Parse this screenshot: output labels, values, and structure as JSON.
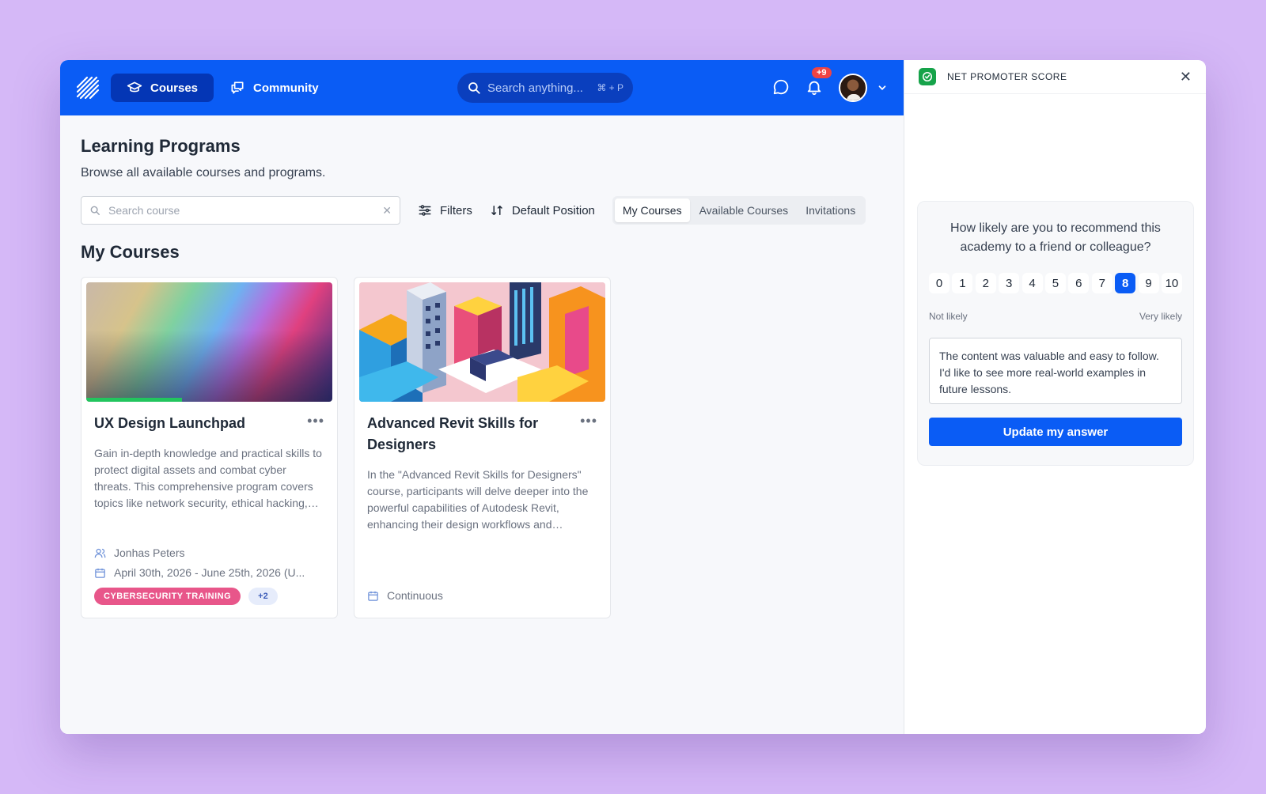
{
  "topbar": {
    "nav": [
      {
        "label": "Courses",
        "icon": "graduation-cap-icon",
        "active": true
      },
      {
        "label": "Community",
        "icon": "chat-bubbles-icon",
        "active": false
      }
    ],
    "search_placeholder": "Search anything...",
    "search_shortcut": "⌘ + P",
    "notification_count": "+9",
    "brand_color": "#0a5cf5"
  },
  "page": {
    "title": "Learning Programs",
    "subtitle": "Browse all available courses and programs.",
    "search_placeholder": "Search course",
    "filters_label": "Filters",
    "sort_label": "Default Position",
    "tabs": [
      {
        "label": "My Courses",
        "active": true
      },
      {
        "label": "Available Courses",
        "active": false
      },
      {
        "label": "Invitations",
        "active": false
      }
    ],
    "section_title": "My Courses"
  },
  "courses": [
    {
      "title": "UX Design Launchpad",
      "description": "Gain in-depth knowledge and practical skills to protect digital assets and combat cyber threats. This comprehensive program covers topics like network security, ethical hacking, and incident response.",
      "instructor": "Jonhas Peters",
      "dates": "April 30th, 2026 - June 25th, 2026 (U...",
      "tag": "CYBERSECURITY TRAINING",
      "tag_more": "+2",
      "progress": 0.39
    },
    {
      "title": "Advanced Revit Skills for Designers",
      "description": "In the \"Advanced Revit Skills for Designers\" course, participants will delve deeper into the powerful capabilities of Autodesk Revit, enhancing their design workflows and productivity.",
      "schedule": "Continuous"
    }
  ],
  "nps": {
    "header": "NET PROMOTER SCORE",
    "question": "How likely are you to recommend this academy to a friend or colleague?",
    "scale": [
      "0",
      "1",
      "2",
      "3",
      "4",
      "5",
      "6",
      "7",
      "8",
      "9",
      "10"
    ],
    "selected": "8",
    "low_label": "Not likely",
    "high_label": "Very likely",
    "answer": "The content was valuable and easy to follow. I'd like to see more real-world examples in future lessons.",
    "button_label": "Update my answer"
  }
}
